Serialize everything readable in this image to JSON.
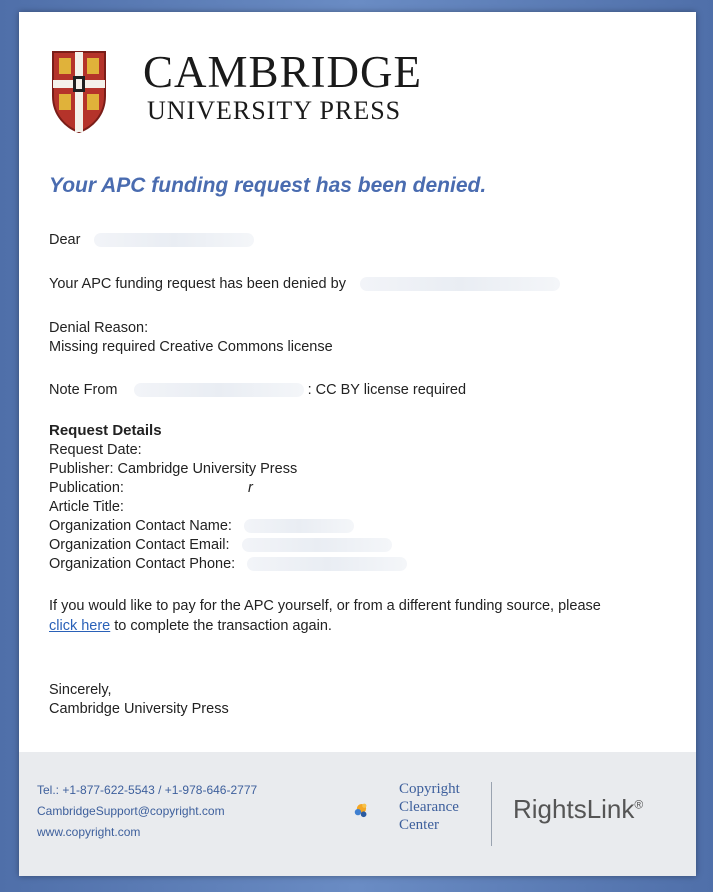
{
  "header": {
    "brand_name": "CAMBRIDGE",
    "brand_sub": "UNIVERSITY PRESS"
  },
  "email": {
    "headline": "Your APC funding request has been denied.",
    "dear": "Dear",
    "denied_by": "Your APC funding request has been denied by",
    "denial_reason_label": "Denial Reason:",
    "denial_reason": "Missing required Creative Commons license",
    "note_from": "Note From",
    "note_text": ": CC BY license required",
    "details_title": "Request Details",
    "request_date": "Request Date:",
    "publisher": "Publisher: Cambridge University Press",
    "publication": "Publication:",
    "publication_mark": "r",
    "article_title": "Article Title:",
    "contact_name": "Organization Contact Name:",
    "contact_email": "Organization Contact Email:",
    "contact_phone": "Organization Contact Phone:",
    "pay_text_1": "If you would like to pay for the APC yourself, or from a different funding source, please",
    "click_here": "click here",
    "pay_text_2": " to complete the transaction again.",
    "sincerely": "Sincerely,",
    "signature": "Cambridge University Press"
  },
  "footer": {
    "phone": "Tel.: +1-877-622-5543 / +1-978-646-2777",
    "email": "CambridgeSupport@copyright.com",
    "website": "www.copyright.com",
    "ccc_line1": "Copyright",
    "ccc_line2": "Clearance",
    "ccc_line3": "Center",
    "rightslink": "RightsLink",
    "rightslink_mark": "®"
  },
  "colors": {
    "headline": "#4a6cb0",
    "link": "#2a61b8",
    "footer_text": "#3d5f9c"
  }
}
